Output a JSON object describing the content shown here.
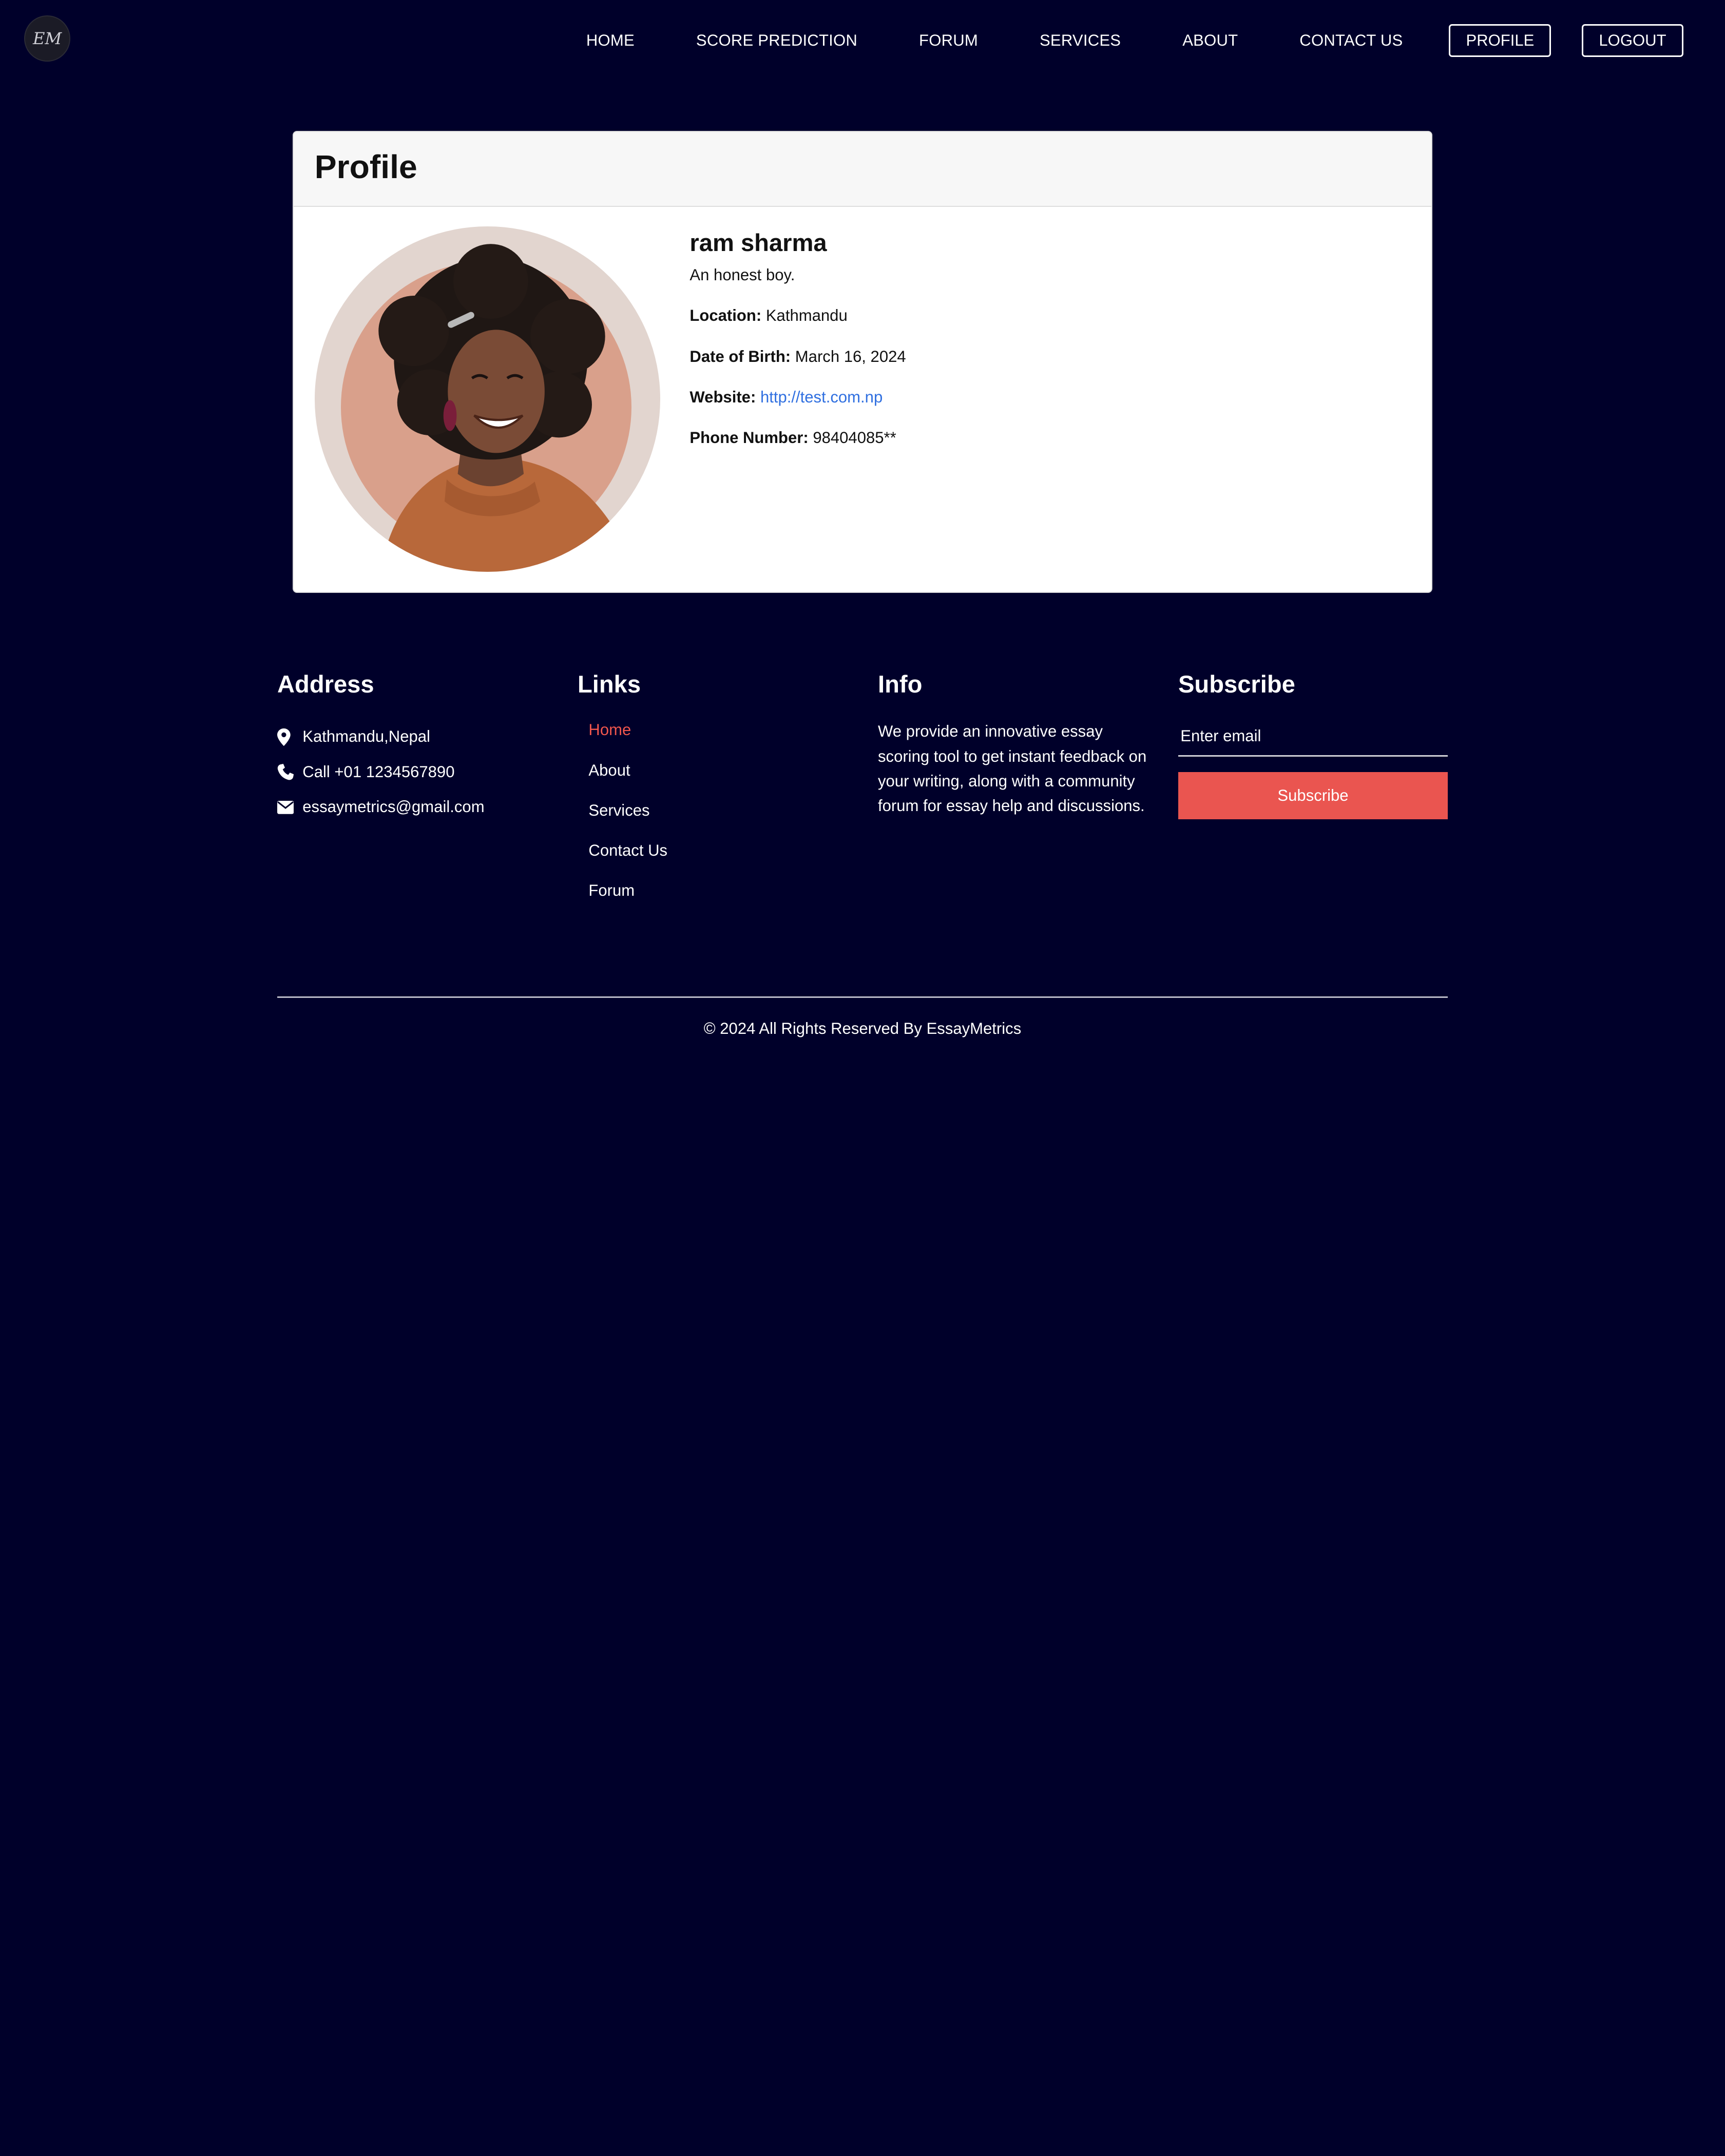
{
  "nav": {
    "logo_text": "EM",
    "links": [
      "HOME",
      "SCORE PREDICTION",
      "FORUM",
      "SERVICES",
      "ABOUT",
      "CONTACT US"
    ],
    "profile_button": "PROFILE",
    "logout_button": "LOGOUT"
  },
  "profile": {
    "title": "Profile",
    "name": "ram sharma",
    "bio": "An honest boy.",
    "location_label": "Location:",
    "location": "Kathmandu",
    "dob_label": "Date of Birth:",
    "dob": "March 16, 2024",
    "website_label": "Website:",
    "website": "http://test.com.np",
    "phone_label": "Phone Number:",
    "phone": "98404085**"
  },
  "footer": {
    "address": {
      "title": "Address",
      "location": "Kathmandu,Nepal",
      "phone": "Call +01 1234567890",
      "email": "essaymetrics@gmail.com"
    },
    "links": {
      "title": "Links",
      "items": [
        "Home",
        "About",
        "Services",
        "Contact Us",
        "Forum"
      ]
    },
    "info": {
      "title": "Info",
      "text": "We provide an innovative essay scoring tool to get instant feedback on your writing, along with a community forum for essay help and discussions."
    },
    "subscribe": {
      "title": "Subscribe",
      "placeholder": "Enter email",
      "button": "Subscribe"
    },
    "copyright": "© 2024 All Rights Reserved By EssayMetrics"
  },
  "colors": {
    "background": "#00002a",
    "accent": "#ea5550",
    "link": "#2f6fe0"
  }
}
